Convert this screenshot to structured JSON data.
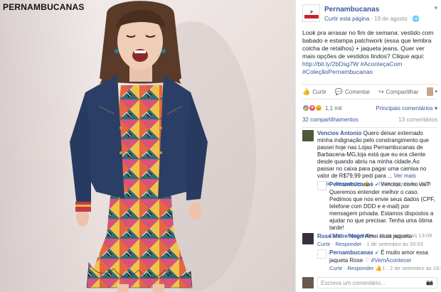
{
  "brand": "PERNAMBUCANAS",
  "post": {
    "page_name": "Pernambucanas",
    "like_page": "Curtir esta página",
    "date": "· 19 de agosto ·",
    "text": "Look pra arrasar no fim de semana: vestido com babado e estampa patchwork (essa que lembra colcha de retalhos) + jaqueta jeans. Quer ver mais opções de vestidos lindos? Clique aqui:",
    "link": "http://bit.ly/2bDsg7W",
    "hashtag1": "#AconteçaCom",
    "hashtag2": "#ColeçãoPernambucanas"
  },
  "actions": {
    "like": "Curtir",
    "comment": "Comentar",
    "share": "Compartilhar"
  },
  "reactions": {
    "count": "1,1 mil",
    "sort": "Principais comentários ▾"
  },
  "counts": {
    "shares": "32 compartilhamentos",
    "comments": "13 comentários"
  },
  "comments": [
    {
      "name": "Vencios Antonio",
      "text": "Quero deixar externado minha indignação pelo constrangimento que passei hoje nas Lojas Pernambucanas de Barbacena-MG,loja está que eu era cliente desde quando abriu na minha cidade.Ao passar no caixa para pagar uma camisa no valor de R$79,99 pedi para ...",
      "more": "Ver mais",
      "like": "Curtir",
      "reply": "Responder",
      "likes": "4",
      "date": "· 19 de agosto às 19:06"
    },
    {
      "name": "Pernambucanas",
      "text": "Vencios, como vai? Queremos entender melhor o caso. Pedimos que nos envie seus dados (CPF, telefone com DDD e e-mail) por mensagem privada. Estamos dispostos a ajudar no que precisar. Tenha uma ótima tarde!",
      "like": "Curtir",
      "reply": "Responder",
      "date": "· 25 de agosto às 13:09"
    },
    {
      "name": "Rose Meire Negri",
      "text": "Amei essa jaqueta",
      "like": "Curtir",
      "reply": "Responder",
      "date": "· 1 de setembro às 20:53"
    },
    {
      "name": "Pernambucanas",
      "text": "É muito amor essa jaqueta Rose",
      "hashtag": "#VemAcontecer",
      "like": "Curtir",
      "reply": "Responder",
      "likes": "1",
      "date": "· 2 de setembro às 16:54"
    }
  ],
  "compose": {
    "placeholder": "Escreva um comentário..."
  },
  "colors": {
    "link": "#365899",
    "muted": "#90949c",
    "like_reaction": "#5890ff",
    "love_reaction": "#f25268",
    "wow_reaction": "#f7b125",
    "denim": "#2b3f66"
  }
}
